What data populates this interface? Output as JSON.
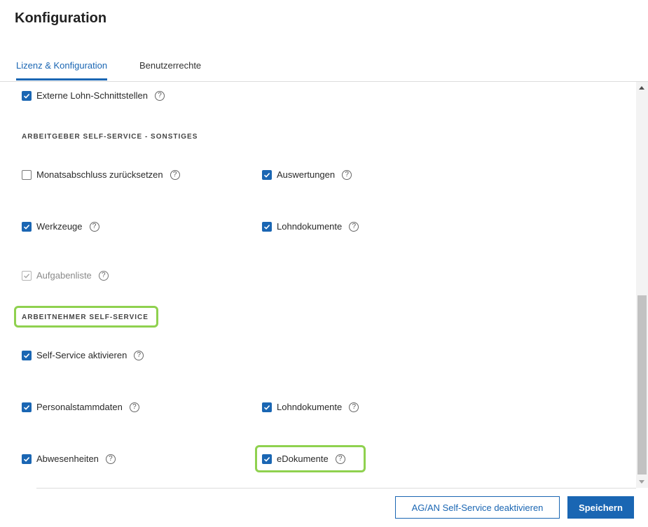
{
  "page": {
    "title": "Konfiguration"
  },
  "tabs": [
    {
      "label": "Lizenz & Konfiguration",
      "active": true
    },
    {
      "label": "Benutzerrechte",
      "active": false
    }
  ],
  "items": {
    "externe_lohn": {
      "label": "Externe Lohn-Schnittstellen",
      "state": "checked"
    },
    "monatsabschluss": {
      "label": "Monatsabschluss zurücksetzen",
      "state": "unchecked"
    },
    "auswertungen": {
      "label": "Auswertungen",
      "state": "checked"
    },
    "werkzeuge": {
      "label": "Werkzeuge",
      "state": "checked"
    },
    "lohndokumente_ag": {
      "label": "Lohndokumente",
      "state": "checked"
    },
    "aufgabenliste": {
      "label": "Aufgabenliste",
      "state": "disabled-checked"
    },
    "self_service": {
      "label": "Self-Service aktivieren",
      "state": "checked"
    },
    "personalstammdaten": {
      "label": "Personalstammdaten",
      "state": "checked"
    },
    "lohndokumente_an": {
      "label": "Lohndokumente",
      "state": "checked"
    },
    "abwesenheiten": {
      "label": "Abwesenheiten",
      "state": "checked"
    },
    "edokumente": {
      "label": "eDokumente",
      "state": "checked"
    }
  },
  "sections": {
    "ag_sonstiges": "ARBEITGEBER SELF-SERVICE - SONSTIGES",
    "an": "ARBEITNEHMER SELF-SERVICE"
  },
  "help_glyph": "?",
  "buttons": {
    "deactivate": "AG/AN Self-Service deaktivieren",
    "save": "Speichern"
  },
  "colors": {
    "accent": "#1a66b3",
    "highlight": "#8fd14f"
  }
}
